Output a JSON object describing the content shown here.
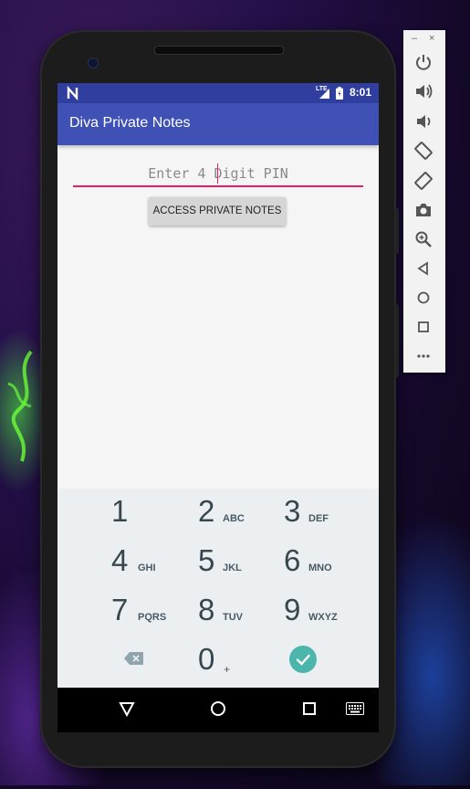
{
  "status_bar": {
    "lte": "LTE",
    "time": "8:01"
  },
  "app_bar": {
    "title": "Diva Private Notes"
  },
  "pin_field": {
    "placeholder": "Enter 4 Digit PIN",
    "value": ""
  },
  "access_button": {
    "label": "ACCESS PRIVATE NOTES"
  },
  "keypad": {
    "keys": [
      {
        "digit": "1",
        "letters": ""
      },
      {
        "digit": "2",
        "letters": "ABC"
      },
      {
        "digit": "3",
        "letters": "DEF"
      },
      {
        "digit": "4",
        "letters": "GHI"
      },
      {
        "digit": "5",
        "letters": "JKL"
      },
      {
        "digit": "6",
        "letters": "MNO"
      },
      {
        "digit": "7",
        "letters": "PQRS"
      },
      {
        "digit": "8",
        "letters": "TUV"
      },
      {
        "digit": "9",
        "letters": "WXYZ"
      }
    ],
    "zero": {
      "digit": "0",
      "letters": "+"
    }
  },
  "nav_bar": {
    "icons": [
      "back-icon",
      "home-icon",
      "recents-icon",
      "keyboard-icon"
    ]
  },
  "emulator_toolbar": {
    "window_controls": {
      "minimize": "–",
      "close": "×"
    },
    "icons": [
      "power-icon",
      "volume-up-icon",
      "volume-down-icon",
      "rotate-left-icon",
      "rotate-right-icon",
      "camera-icon",
      "zoom-icon",
      "back-icon",
      "home-icon",
      "overview-icon",
      "more-icon"
    ]
  },
  "colors": {
    "primary": "#3f51b5",
    "primary_dark": "#303f9f",
    "accent": "#e91e63",
    "done_button": "#4db6ac",
    "keypad_bg": "#eceff1"
  }
}
